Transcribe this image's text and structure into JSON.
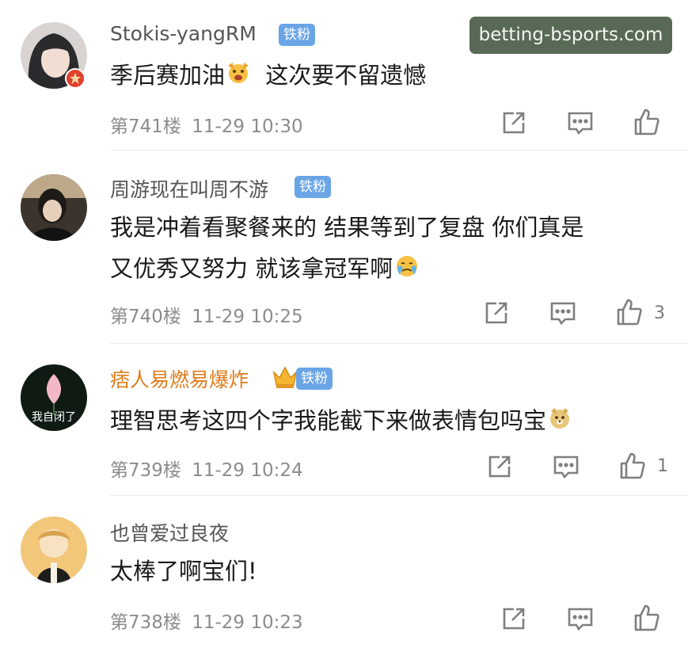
{
  "watermark": "betting-bsports.com",
  "fan_badge": "铁粉",
  "avatar3_text": "我自闭了",
  "comments": [
    {
      "name": "Stokis-yangRM",
      "text": "季后赛加油",
      "text2": "这次要不留遗憾",
      "floor": "第741楼",
      "time": "11-29 10:30",
      "likes": ""
    },
    {
      "name": "周游现在叫周不游",
      "text": "我是冲着看聚餐来的 结果等到了复盘 你们真是",
      "text2": "又优秀又努力 就该拿冠军啊",
      "floor": "第740楼",
      "time": "11-29 10:25",
      "likes": "3"
    },
    {
      "name": "痞人易燃易爆炸",
      "text": "理智思考这四个字我能截下来做表情包吗宝",
      "floor": "第739楼",
      "time": "11-29 10:24",
      "likes": "1"
    },
    {
      "name": "也曾爱过良夜",
      "text": "太棒了啊宝们!",
      "floor": "第738楼",
      "time": "11-29 10:23",
      "likes": ""
    }
  ],
  "icons": {
    "repost": "share-box-icon",
    "comment": "comment-bubble-icon",
    "like": "thumbs-up-icon"
  },
  "colors": {
    "fan_badge": "#6aa5e6",
    "vip_name": "#e07b1a",
    "watermark_bg": "#586955",
    "verified_badge": "#e0412f"
  }
}
